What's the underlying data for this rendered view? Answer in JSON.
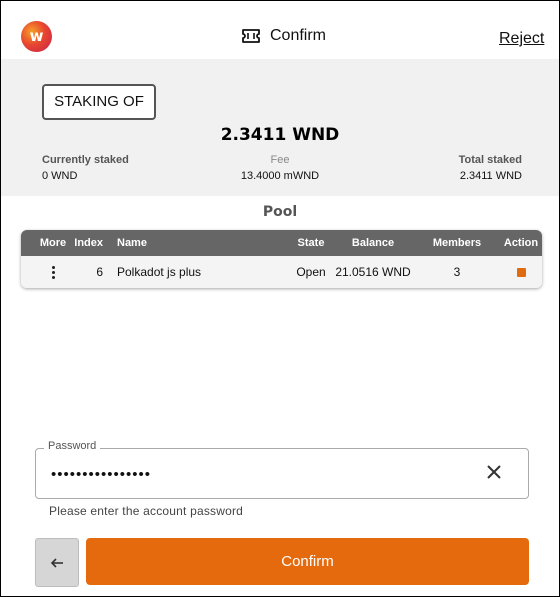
{
  "header": {
    "logo_letter": "w",
    "title": "Confirm",
    "reject_label": "Reject"
  },
  "summary": {
    "staking_label": "STAKING OF",
    "amount": "2.3411  WND",
    "currently_staked_label": "Currently staked",
    "currently_staked_value": "0 WND",
    "fee_label": "Fee",
    "fee_value": "13.4000 mWND",
    "total_staked_label": "Total staked",
    "total_staked_value": "2.3411 WND"
  },
  "pool": {
    "title": "Pool",
    "columns": [
      "More",
      "Index",
      "Name",
      "State",
      "Balance",
      "Members",
      "Action"
    ],
    "rows": [
      {
        "index": "6",
        "name": "Polkadot js plus",
        "state": "Open",
        "balance": "21.0516 WND",
        "members": "3"
      }
    ]
  },
  "password": {
    "label": "Password",
    "value": "••••••••••••••••",
    "helper": "Please enter the account password"
  },
  "actions": {
    "back_icon": "arrow-left-icon",
    "confirm_label": "Confirm"
  },
  "colors": {
    "accent": "#e56a0d",
    "header_row": "#666666",
    "summary_bg": "#f1f1f1"
  }
}
